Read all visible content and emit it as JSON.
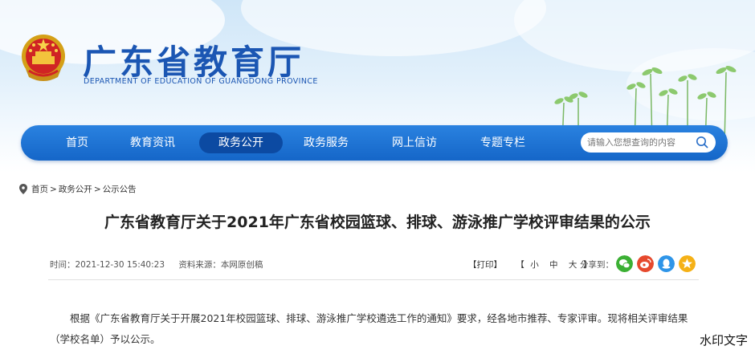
{
  "header": {
    "site_title": "广东省教育厅",
    "site_subtitle": "DEPARTMENT OF EDUCATION OF GUANGDONG PROVINCE"
  },
  "nav": {
    "items": [
      {
        "label": "首页",
        "active": false
      },
      {
        "label": "教育资讯",
        "active": false
      },
      {
        "label": "政务公开",
        "active": true
      },
      {
        "label": "政务服务",
        "active": false
      },
      {
        "label": "网上信访",
        "active": false
      },
      {
        "label": "专题专栏",
        "active": false
      }
    ],
    "search_placeholder": "请输入您想查询的内容"
  },
  "breadcrumb": {
    "items": [
      "首页",
      "政务公开",
      "公示公告"
    ],
    "separator": ">"
  },
  "article": {
    "title": "广东省教育厅关于2021年广东省校园篮球、排球、游泳推广学校评审结果的公示",
    "time": "时间：2021-12-30 15:40:23",
    "source": "资料来源：本网原创稿",
    "print_label": "【打印】",
    "size_open": "【",
    "size_small": "小",
    "size_medium": "中",
    "size_large": "大",
    "size_close": "】",
    "share_label": "分享到：",
    "body": "根据《广东省教育厅关于开展2021年校园篮球、排球、游泳推广学校遴选工作的通知》要求，经各地市推荐、专家评审。现将相关评审结果（学校名单）予以公示。"
  },
  "share_icons": [
    {
      "name": "wechat-icon",
      "color": "#3cb034"
    },
    {
      "name": "weibo-icon",
      "color": "#e6492d"
    },
    {
      "name": "qq-icon",
      "color": "#2f95e8"
    },
    {
      "name": "qzone-icon",
      "color": "#f5b117"
    }
  ],
  "watermark": "水印文字",
  "colors": {
    "brand": "#1b56b3",
    "nav": "#1a6fd2",
    "nav_active": "#0c4aa2"
  }
}
